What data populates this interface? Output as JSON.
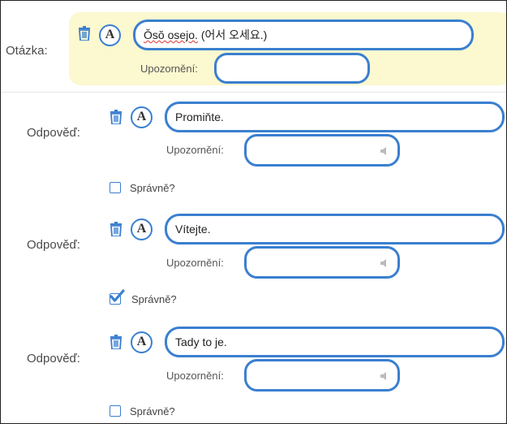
{
  "question": {
    "label": "Otázka:",
    "text_romanized": "Ŏsŏ osejo.",
    "text_korean": " (어서 오세요.)",
    "note_label": "Upozornění:",
    "note_value": ""
  },
  "answers": [
    {
      "label": "Odpověď:",
      "text": "Promiňte.",
      "note_label": "Upozornění:",
      "note_value": "",
      "correct_label": "Správně?",
      "correct": false
    },
    {
      "label": "Odpověď:",
      "text": "Vítejte.",
      "note_label": "Upozornění:",
      "note_value": "",
      "correct_label": "Správně?",
      "correct": true
    },
    {
      "label": "Odpověď:",
      "text": "Tady to je.",
      "note_label": "Upozornění:",
      "note_value": "",
      "correct_label": "Správně?",
      "correct": false
    }
  ],
  "icons": {
    "delete": "trash-icon",
    "font": "letter-a-icon",
    "audio": "speaker-icon",
    "check": "checkmark-icon"
  },
  "colors": {
    "accent": "#3a7fd0",
    "question_bg": "#fcf8cf"
  }
}
